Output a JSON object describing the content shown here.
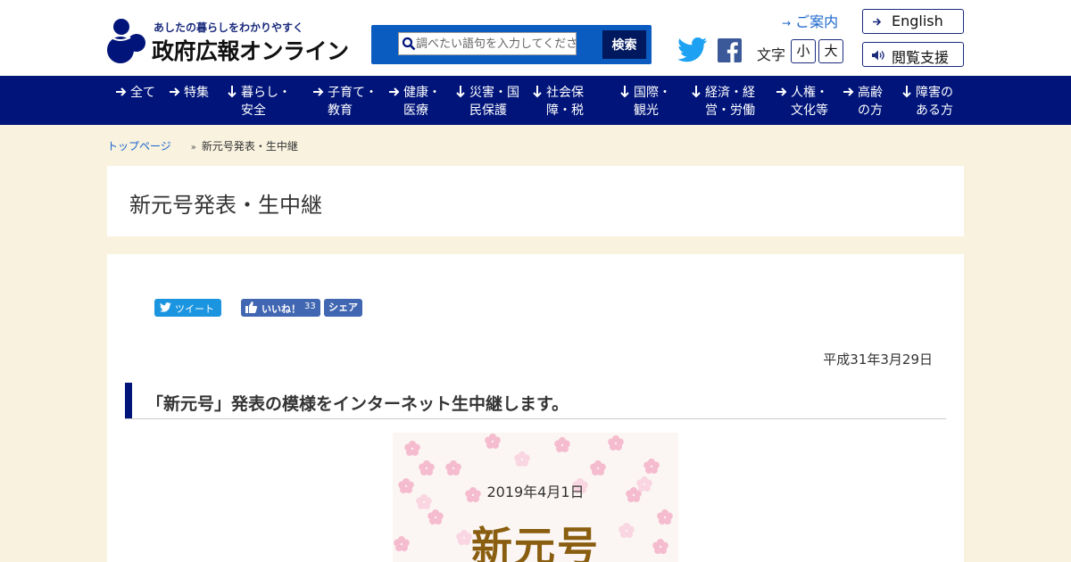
{
  "header": {
    "tagline": "あしたの暮らしをわかりやすく",
    "site_name": "政府広報オンライン",
    "search": {
      "placeholder": "調べたい語句を入力してください",
      "button_label": "検索"
    },
    "guide_label": "ご案内",
    "english_label": "English",
    "access_label": "閲覧支援",
    "text_size": {
      "label": "文字",
      "small": "小",
      "large": "大"
    }
  },
  "nav": {
    "items": [
      {
        "line1": "全て",
        "line2": ""
      },
      {
        "line1": "特集",
        "line2": ""
      },
      {
        "line1": "暮らし・",
        "line2": "安全"
      },
      {
        "line1": "子育て・",
        "line2": "教育"
      },
      {
        "line1": "健康・",
        "line2": "医療"
      },
      {
        "line1": "災害・国",
        "line2": "民保護"
      },
      {
        "line1": "社会保",
        "line2": "障・税"
      },
      {
        "line1": "国際・",
        "line2": "観光"
      },
      {
        "line1": "経済・経",
        "line2": "営・労働"
      },
      {
        "line1": "人権・",
        "line2": "文化等"
      },
      {
        "line1": "高齢",
        "line2": "の方"
      },
      {
        "line1": "障害の",
        "line2": "ある方"
      }
    ]
  },
  "breadcrumb": {
    "home": "トップページ",
    "separator": "»",
    "current": "新元号発表・生中継"
  },
  "page": {
    "title": "新元号発表・生中継",
    "social": {
      "tweet": "ツイート",
      "like": "いいね！",
      "like_count": "33",
      "share": "シェア"
    },
    "date": "平成31年3月29日",
    "section_title": "「新元号」発表の模様をインターネット生中継します。",
    "hero": {
      "date": "2019年4月1日",
      "era_text": "新元号"
    }
  },
  "colors": {
    "nav_bg": "#00147a",
    "search_bg": "#0b5cc0",
    "search_button": "#00195e",
    "link": "#1a66cc",
    "page_bg": "#f8f2df",
    "twitter": "#1b95e0",
    "facebook": "#4267b2",
    "hero_text": "#8a5e10"
  }
}
